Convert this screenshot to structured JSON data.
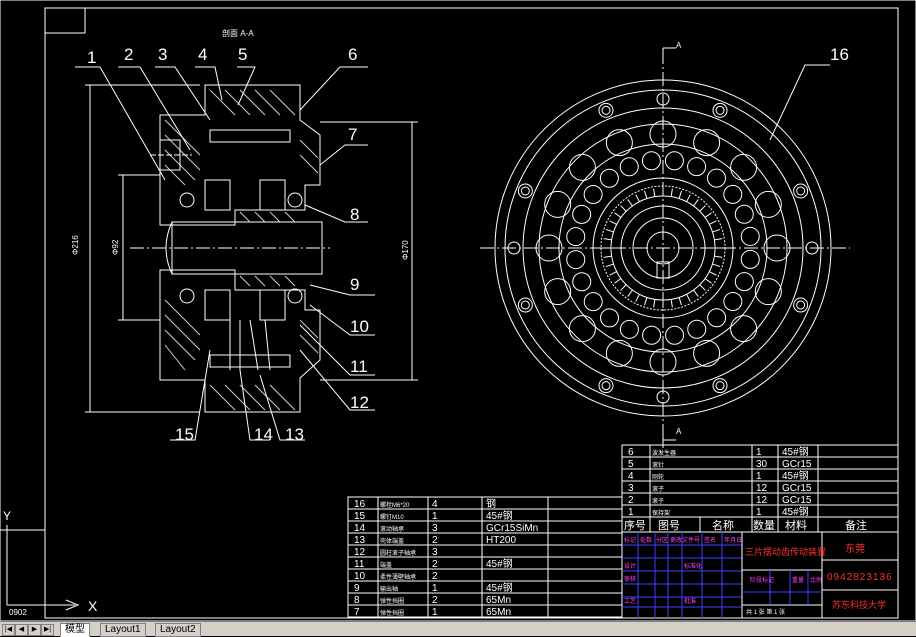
{
  "section_label": "剖面 A-A",
  "section_mark": "A",
  "dimensions": {
    "outer_diameter": "Φ216",
    "bore_diameter": "Φ92",
    "height": "Φ170"
  },
  "left_bubbles": [
    "1",
    "2",
    "3",
    "4",
    "5",
    "6",
    "7",
    "8",
    "9",
    "10",
    "11",
    "12",
    "13",
    "14",
    "15"
  ],
  "right_bubble": "16",
  "coord_mark": "Y",
  "coord_mark_x": "X",
  "corner_code": "0902",
  "bom_left": [
    {
      "no": "16",
      "name": "螺栓M6*20",
      "qty": "4",
      "mat": "钢"
    },
    {
      "no": "15",
      "name": "螺钉M10",
      "qty": "1",
      "mat": "45#钢"
    },
    {
      "no": "14",
      "name": "滚动轴承",
      "qty": "3",
      "mat": "GCr15SiMn"
    },
    {
      "no": "13",
      "name": "壳体端盖",
      "qty": "2",
      "mat": "HT200"
    },
    {
      "no": "12",
      "name": "圆柱滚子轴承",
      "qty": "3",
      "mat": ""
    },
    {
      "no": "11",
      "name": "端盖",
      "qty": "2",
      "mat": "45#钢"
    },
    {
      "no": "10",
      "name": "柔性薄壁轴承",
      "qty": "2",
      "mat": ""
    },
    {
      "no": "9",
      "name": "输出轴",
      "qty": "1",
      "mat": "45#钢"
    },
    {
      "no": "8",
      "name": "弹性挡圈",
      "qty": "2",
      "mat": "65Mn"
    },
    {
      "no": "7",
      "name": "弹性挡圈",
      "qty": "1",
      "mat": "65Mn"
    }
  ],
  "bom_right": [
    {
      "no": "6",
      "name": "波发生器",
      "qty": "1",
      "mat": "45#钢"
    },
    {
      "no": "5",
      "name": "滚针",
      "qty": "30",
      "mat": "GCr15"
    },
    {
      "no": "4",
      "name": "刚轮",
      "qty": "1",
      "mat": "45#钢"
    },
    {
      "no": "3",
      "name": "滚子",
      "qty": "12",
      "mat": "GCr15"
    },
    {
      "no": "2",
      "name": "滚子",
      "qty": "12",
      "mat": "GCr15"
    },
    {
      "no": "1",
      "name": "保持架",
      "qty": "1",
      "mat": "45#钢"
    }
  ],
  "bom_header": {
    "no": "序号",
    "drawing": "图号",
    "name": "名称",
    "qty": "数量",
    "mat": "材料",
    "note": "备注"
  },
  "title_block": {
    "title": "三片摆动齿传动装置",
    "designer": "东莞",
    "student_id": "0942823136",
    "school": "苏东科技大学",
    "sheet": "共 1 张  第 1 张"
  },
  "tabs": [
    {
      "label": "模型",
      "active": true
    },
    {
      "label": "Layout1",
      "active": false
    },
    {
      "label": "Layout2",
      "active": false
    }
  ],
  "nav_icons": [
    "first-icon",
    "prev-icon",
    "next-icon",
    "last-icon"
  ]
}
